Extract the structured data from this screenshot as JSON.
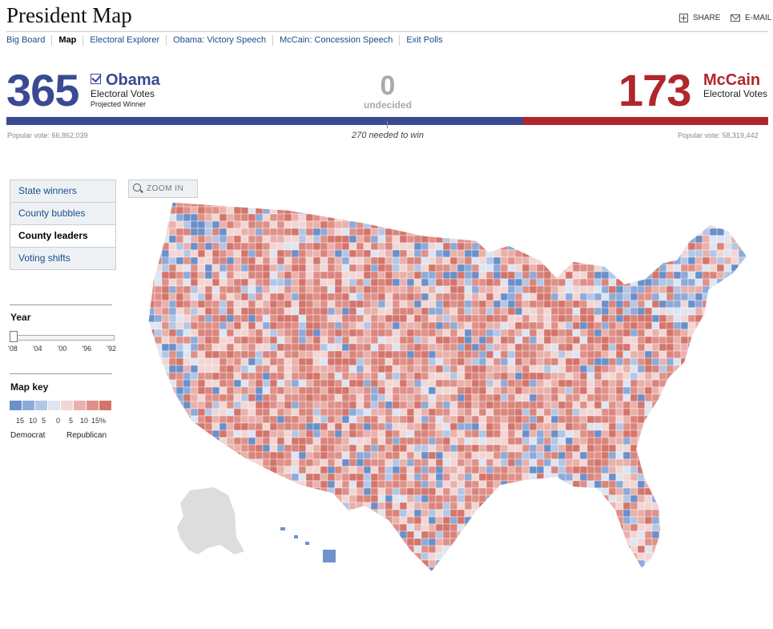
{
  "header": {
    "title": "President Map",
    "share_label": "SHARE",
    "email_label": "E-MAIL"
  },
  "nav": {
    "items": [
      "Big Board",
      "Map",
      "Electoral Explorer",
      "Obama: Victory Speech",
      "McCain: Concession Speech",
      "Exit Polls"
    ],
    "active": "Map"
  },
  "results": {
    "obama": {
      "votes": "365",
      "name": "Obama",
      "ev_label": "Electoral Votes",
      "status": "Projected Winner",
      "popular": "Popular vote: 66,862,039",
      "color": "#3a4a92"
    },
    "undecided": {
      "votes": "0",
      "label": "undecided"
    },
    "mccain": {
      "votes": "173",
      "name": "McCain",
      "ev_label": "Electoral Votes",
      "popular": "Popular vote: 58,319,442",
      "color": "#b0272b"
    },
    "needed": "270 needed to win",
    "obama_share": 0.6784
  },
  "sidebar": {
    "views": [
      "State winners",
      "County bubbles",
      "County leaders",
      "Voting shifts"
    ],
    "active_view": "County leaders",
    "year_title": "Year",
    "years": [
      "'08",
      "'04",
      "'00",
      "'96",
      "'92"
    ],
    "selected_year": "'08",
    "key_title": "Map key",
    "key_colors": [
      "#6b8fc9",
      "#8eaad8",
      "#b3c6e6",
      "#dde4f2",
      "#f2d6d4",
      "#e9b1ab",
      "#df9189",
      "#d4756c"
    ],
    "key_numbers": [
      "15",
      "10",
      "5",
      "0",
      "5",
      "10",
      "15%"
    ],
    "democrat_label": "Democrat",
    "republican_label": "Republican"
  },
  "map": {
    "zoom_label": "ZOOM IN",
    "republican_color": "#d9857c",
    "democrat_color": "#6f93cb",
    "no_data_color": "#dddddd"
  }
}
